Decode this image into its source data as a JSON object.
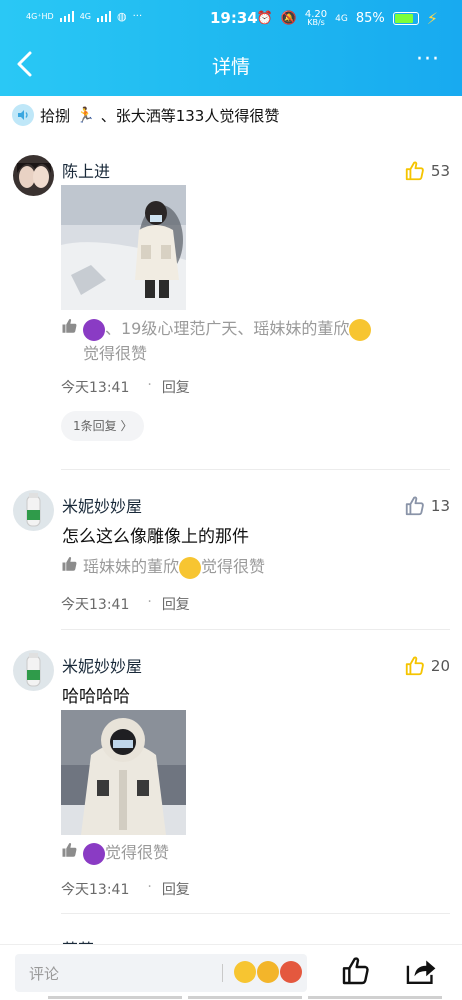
{
  "status_bar": {
    "net1": "4G⁺HD",
    "net2": "4G",
    "time": "19:34",
    "speed_value": "4.20",
    "speed_unit": "KB/s",
    "net3": "4G",
    "battery": "85%",
    "battery_level": 0.85
  },
  "nav": {
    "title": "详情"
  },
  "likes_summary": {
    "text_a": "拾捌",
    "text_b": "、张大洒等133人觉得很赞"
  },
  "comments": [
    {
      "name": "陈上进",
      "likes": "53",
      "liked": true,
      "liked_by_a": "、19级心理范广天、瑶妹妹的董欣",
      "liked_by_b": "觉得很赞",
      "time": "今天13:41",
      "reply": "回复",
      "replies": "1条回复 〉"
    },
    {
      "name": "米妮妙妙屋",
      "likes": "13",
      "liked": false,
      "text": "怎么这么像雕像上的那件",
      "liked_by_a": "瑶妹妹的董欣",
      "liked_by_b": "觉得很赞",
      "time": "今天13:41",
      "reply": "回复"
    },
    {
      "name": "米妮妙妙屋",
      "likes": "20",
      "liked": true,
      "text": "哈哈哈哈",
      "liked_by_b": "觉得很赞",
      "time": "今天13:41",
      "reply": "回复"
    },
    {
      "name": "茜茜"
    }
  ],
  "bottom": {
    "placeholder": "评论"
  },
  "colors": {
    "header": "#1eb7f0",
    "like_yellow": "#f5c400",
    "like_gray": "#8a94a8"
  }
}
